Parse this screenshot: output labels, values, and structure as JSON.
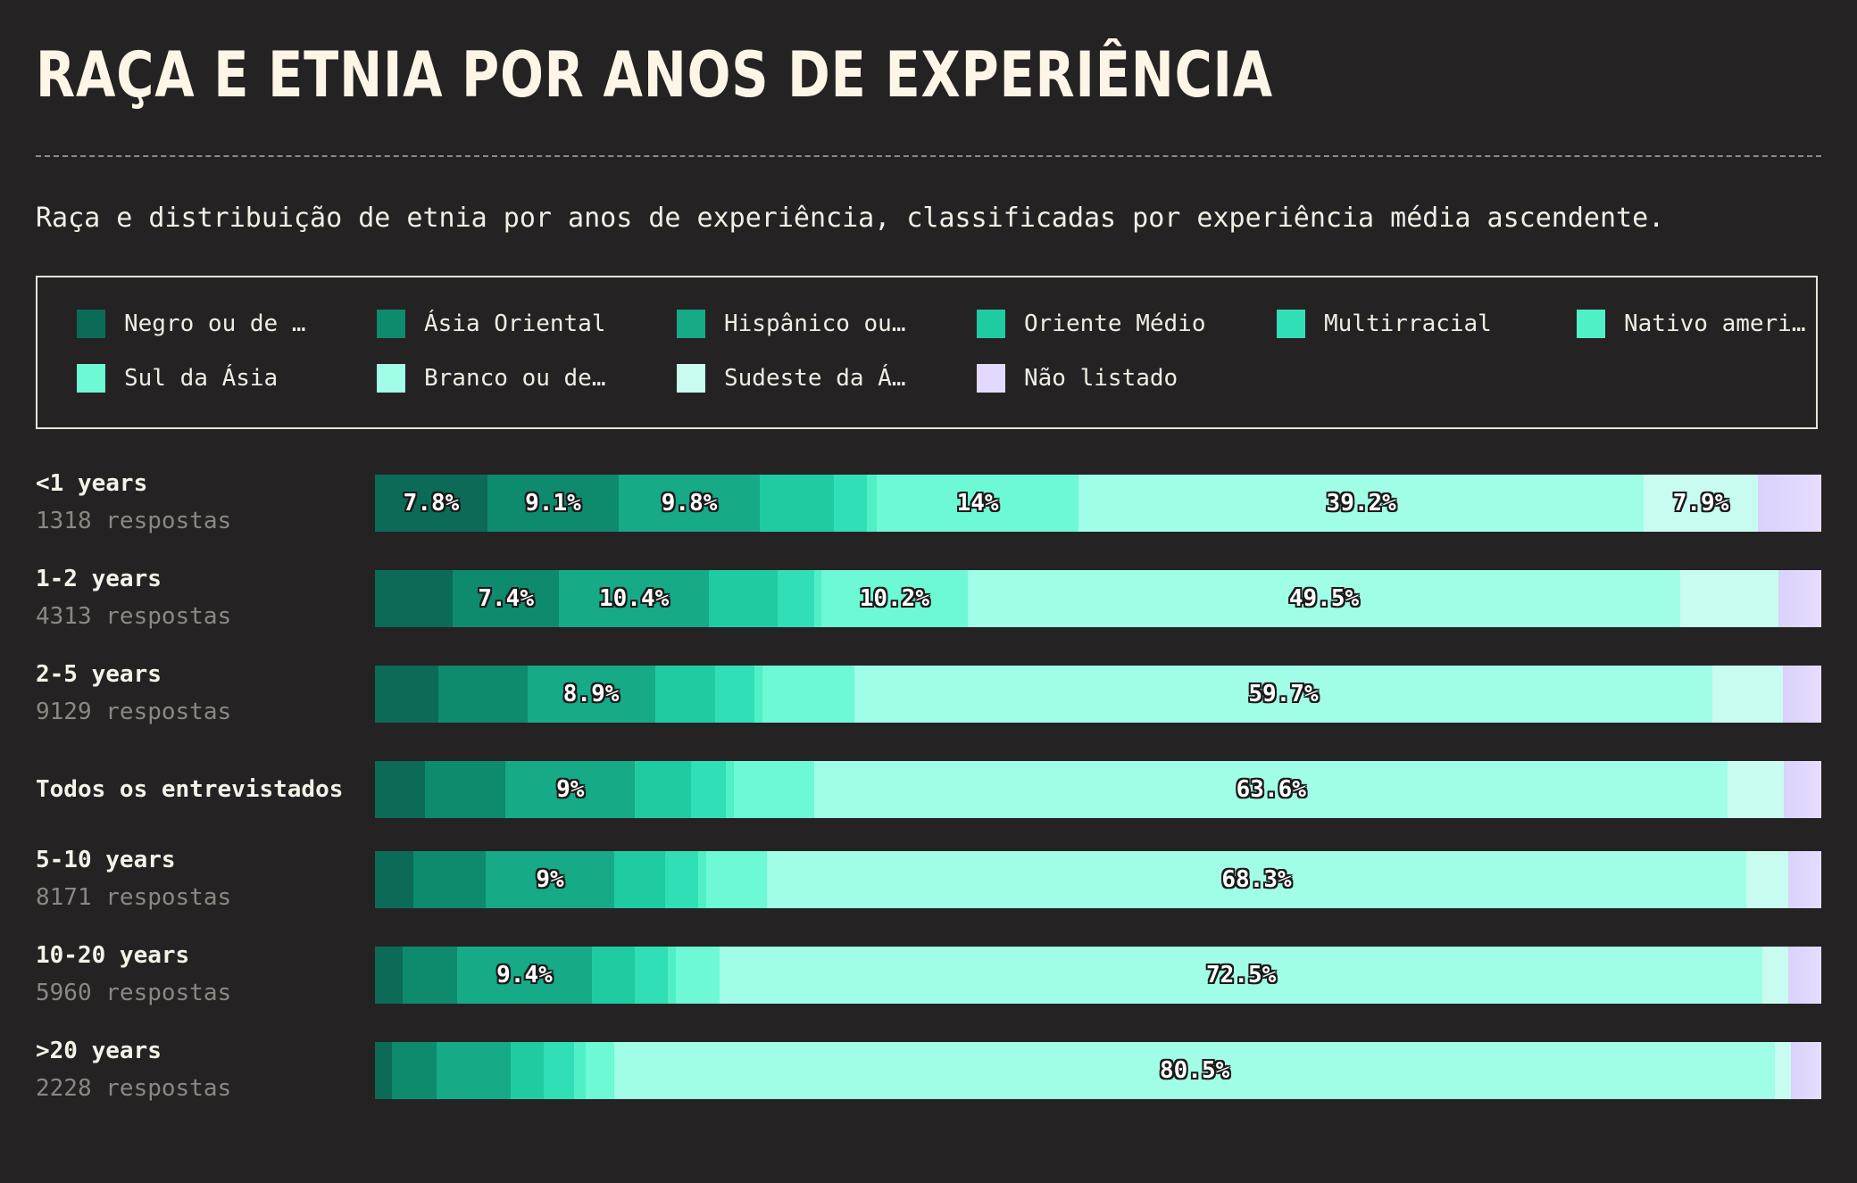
{
  "title": "RAÇA E ETNIA POR ANOS DE EXPERIÊNCIA",
  "subtitle": "Raça e distribuição de etnia por anos de experiência, classificadas por experiência média ascendente.",
  "colors": {
    "background": "#252223",
    "series": [
      "#0b6b56",
      "#0e8a6c",
      "#16aa86",
      "#1fcca2",
      "#30dfb5",
      "#4ff0c6",
      "#6cf9d4",
      "#a0fde6",
      "#c8fcf0",
      "#e3d9ff"
    ]
  },
  "chart_data": {
    "type": "bar",
    "orientation": "horizontal",
    "stacked": true,
    "normalized": true,
    "legend_position": "top",
    "rows": [
      {
        "label": "<1 years",
        "count": "1318 respostas"
      },
      {
        "label": "1-2 years",
        "count": "4313 respostas"
      },
      {
        "label": "2-5 years",
        "count": "9129 respostas"
      },
      {
        "label": "Todos os entrevistados",
        "count": ""
      },
      {
        "label": "5-10 years",
        "count": "8171 respostas"
      },
      {
        "label": "10-20 years",
        "count": "5960 respostas"
      },
      {
        "label": ">20 years",
        "count": "2228 respostas"
      }
    ],
    "series": [
      {
        "name": "Negro ou de …",
        "values": [
          7.8,
          5.4,
          4.4,
          3.5,
          2.7,
          1.9,
          1.2
        ]
      },
      {
        "name": "Ásia Oriental",
        "values": [
          9.1,
          7.4,
          6.2,
          5.6,
          5.0,
          3.8,
          3.1
        ]
      },
      {
        "name": "Hispânico ou…",
        "values": [
          9.8,
          10.4,
          8.9,
          9.0,
          9.0,
          9.4,
          5.1
        ]
      },
      {
        "name": "Oriente Médio",
        "values": [
          5.1,
          4.8,
          4.2,
          3.9,
          3.5,
          3.0,
          2.3
        ]
      },
      {
        "name": "Multirracial",
        "values": [
          2.3,
          2.5,
          2.7,
          2.4,
          2.3,
          2.3,
          2.1
        ]
      },
      {
        "name": "Nativo ameri…",
        "values": [
          0.7,
          0.5,
          0.6,
          0.6,
          0.6,
          0.5,
          0.8
        ]
      },
      {
        "name": "Sul da Ásia",
        "values": [
          14.0,
          10.2,
          6.4,
          5.6,
          4.2,
          3.1,
          2.0
        ]
      },
      {
        "name": "Branco ou de…",
        "values": [
          39.2,
          49.5,
          59.7,
          63.6,
          68.3,
          72.5,
          80.5
        ]
      },
      {
        "name": "Sudeste da Á…",
        "values": [
          7.9,
          6.8,
          4.9,
          3.9,
          2.9,
          1.8,
          1.1
        ]
      },
      {
        "name": "Não listado",
        "values": [
          4.4,
          3.0,
          2.7,
          2.6,
          2.3,
          2.3,
          2.1
        ]
      }
    ],
    "data_labels": [
      [
        "7.8%",
        "9.1%",
        "9.8%",
        "",
        "",
        "",
        "14%",
        "39.2%",
        "7.9%",
        ""
      ],
      [
        "",
        "7.4%",
        "10.4%",
        "",
        "",
        "",
        "10.2%",
        "49.5%",
        "",
        ""
      ],
      [
        "",
        "",
        "8.9%",
        "",
        "",
        "",
        "",
        "59.7%",
        "",
        ""
      ],
      [
        "",
        "",
        "9%",
        "",
        "",
        "",
        "",
        "63.6%",
        "",
        ""
      ],
      [
        "",
        "",
        "9%",
        "",
        "",
        "",
        "",
        "68.3%",
        "",
        ""
      ],
      [
        "",
        "",
        "9.4%",
        "",
        "",
        "",
        "",
        "72.5%",
        "",
        ""
      ],
      [
        "",
        "",
        "",
        "",
        "",
        "",
        "",
        "80.5%",
        "",
        ""
      ]
    ]
  }
}
